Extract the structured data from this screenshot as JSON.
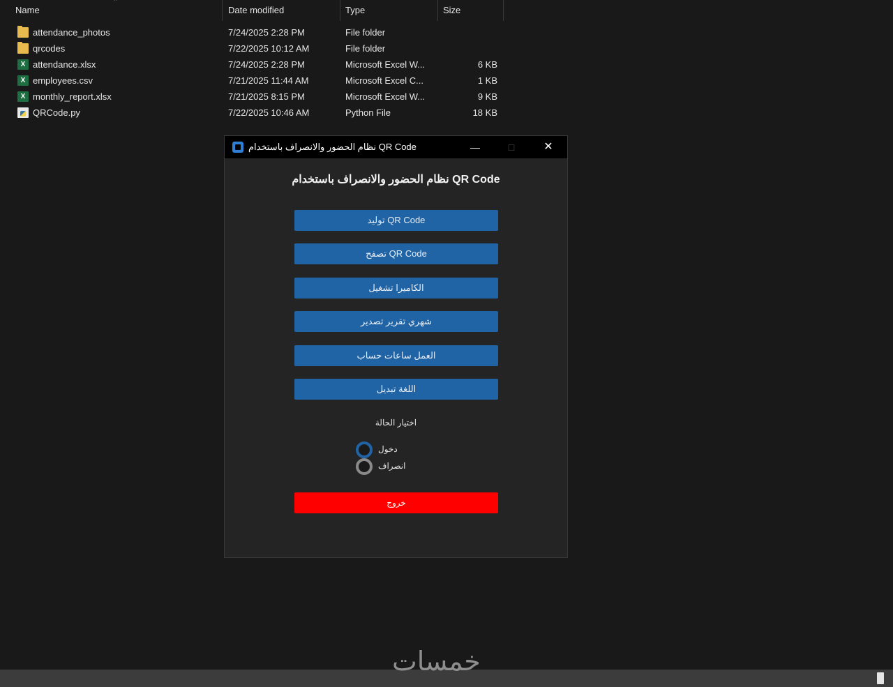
{
  "explorer": {
    "columns": {
      "name": "Name",
      "date": "Date modified",
      "type": "Type",
      "size": "Size"
    },
    "files": [
      {
        "name": "attendance_photos",
        "date": "7/24/2025 2:28 PM",
        "type": "File folder",
        "size": "",
        "icon": "folder-icon"
      },
      {
        "name": "qrcodes",
        "date": "7/22/2025 10:12 AM",
        "type": "File folder",
        "size": "",
        "icon": "folder-icon"
      },
      {
        "name": "attendance.xlsx",
        "date": "7/24/2025 2:28 PM",
        "type": "Microsoft Excel W...",
        "size": "6 KB",
        "icon": "excel-icon"
      },
      {
        "name": "employees.csv",
        "date": "7/21/2025 11:44 AM",
        "type": "Microsoft Excel C...",
        "size": "1 KB",
        "icon": "excel-icon"
      },
      {
        "name": "monthly_report.xlsx",
        "date": "7/21/2025 8:15 PM",
        "type": "Microsoft Excel W...",
        "size": "9 KB",
        "icon": "excel-icon"
      },
      {
        "name": "QRCode.py",
        "date": "7/22/2025 10:46 AM",
        "type": "Python File",
        "size": "18 KB",
        "icon": "python-file-icon"
      }
    ]
  },
  "app": {
    "title": "نظام الحضور والانصراف باستخدام QR Code",
    "heading": "نظام الحضور والانصراف باستخدام QR Code",
    "buttons": [
      {
        "label": "توليد QR Code",
        "name": "generate-qr-button"
      },
      {
        "label": "تصفح QR Code",
        "name": "browse-qr-button"
      },
      {
        "label": "الكاميرا تشغيل",
        "name": "start-camera-button"
      },
      {
        "label": "شهري تقرير تصدير",
        "name": "export-monthly-report-button"
      },
      {
        "label": "العمل ساعات حساب",
        "name": "calculate-work-hours-button"
      },
      {
        "label": "اللغة تبديل",
        "name": "switch-language-button"
      }
    ],
    "state_label": "اختيار الحالة",
    "radio_options": [
      {
        "label": "دخول",
        "selected": true
      },
      {
        "label": "انصراف",
        "selected": false
      }
    ],
    "exit_label": "خروج"
  },
  "watermark": "خمسات",
  "colors": {
    "accent": "#2064a6",
    "exit": "#ff0000",
    "background": "#191919",
    "window": "#242424"
  }
}
